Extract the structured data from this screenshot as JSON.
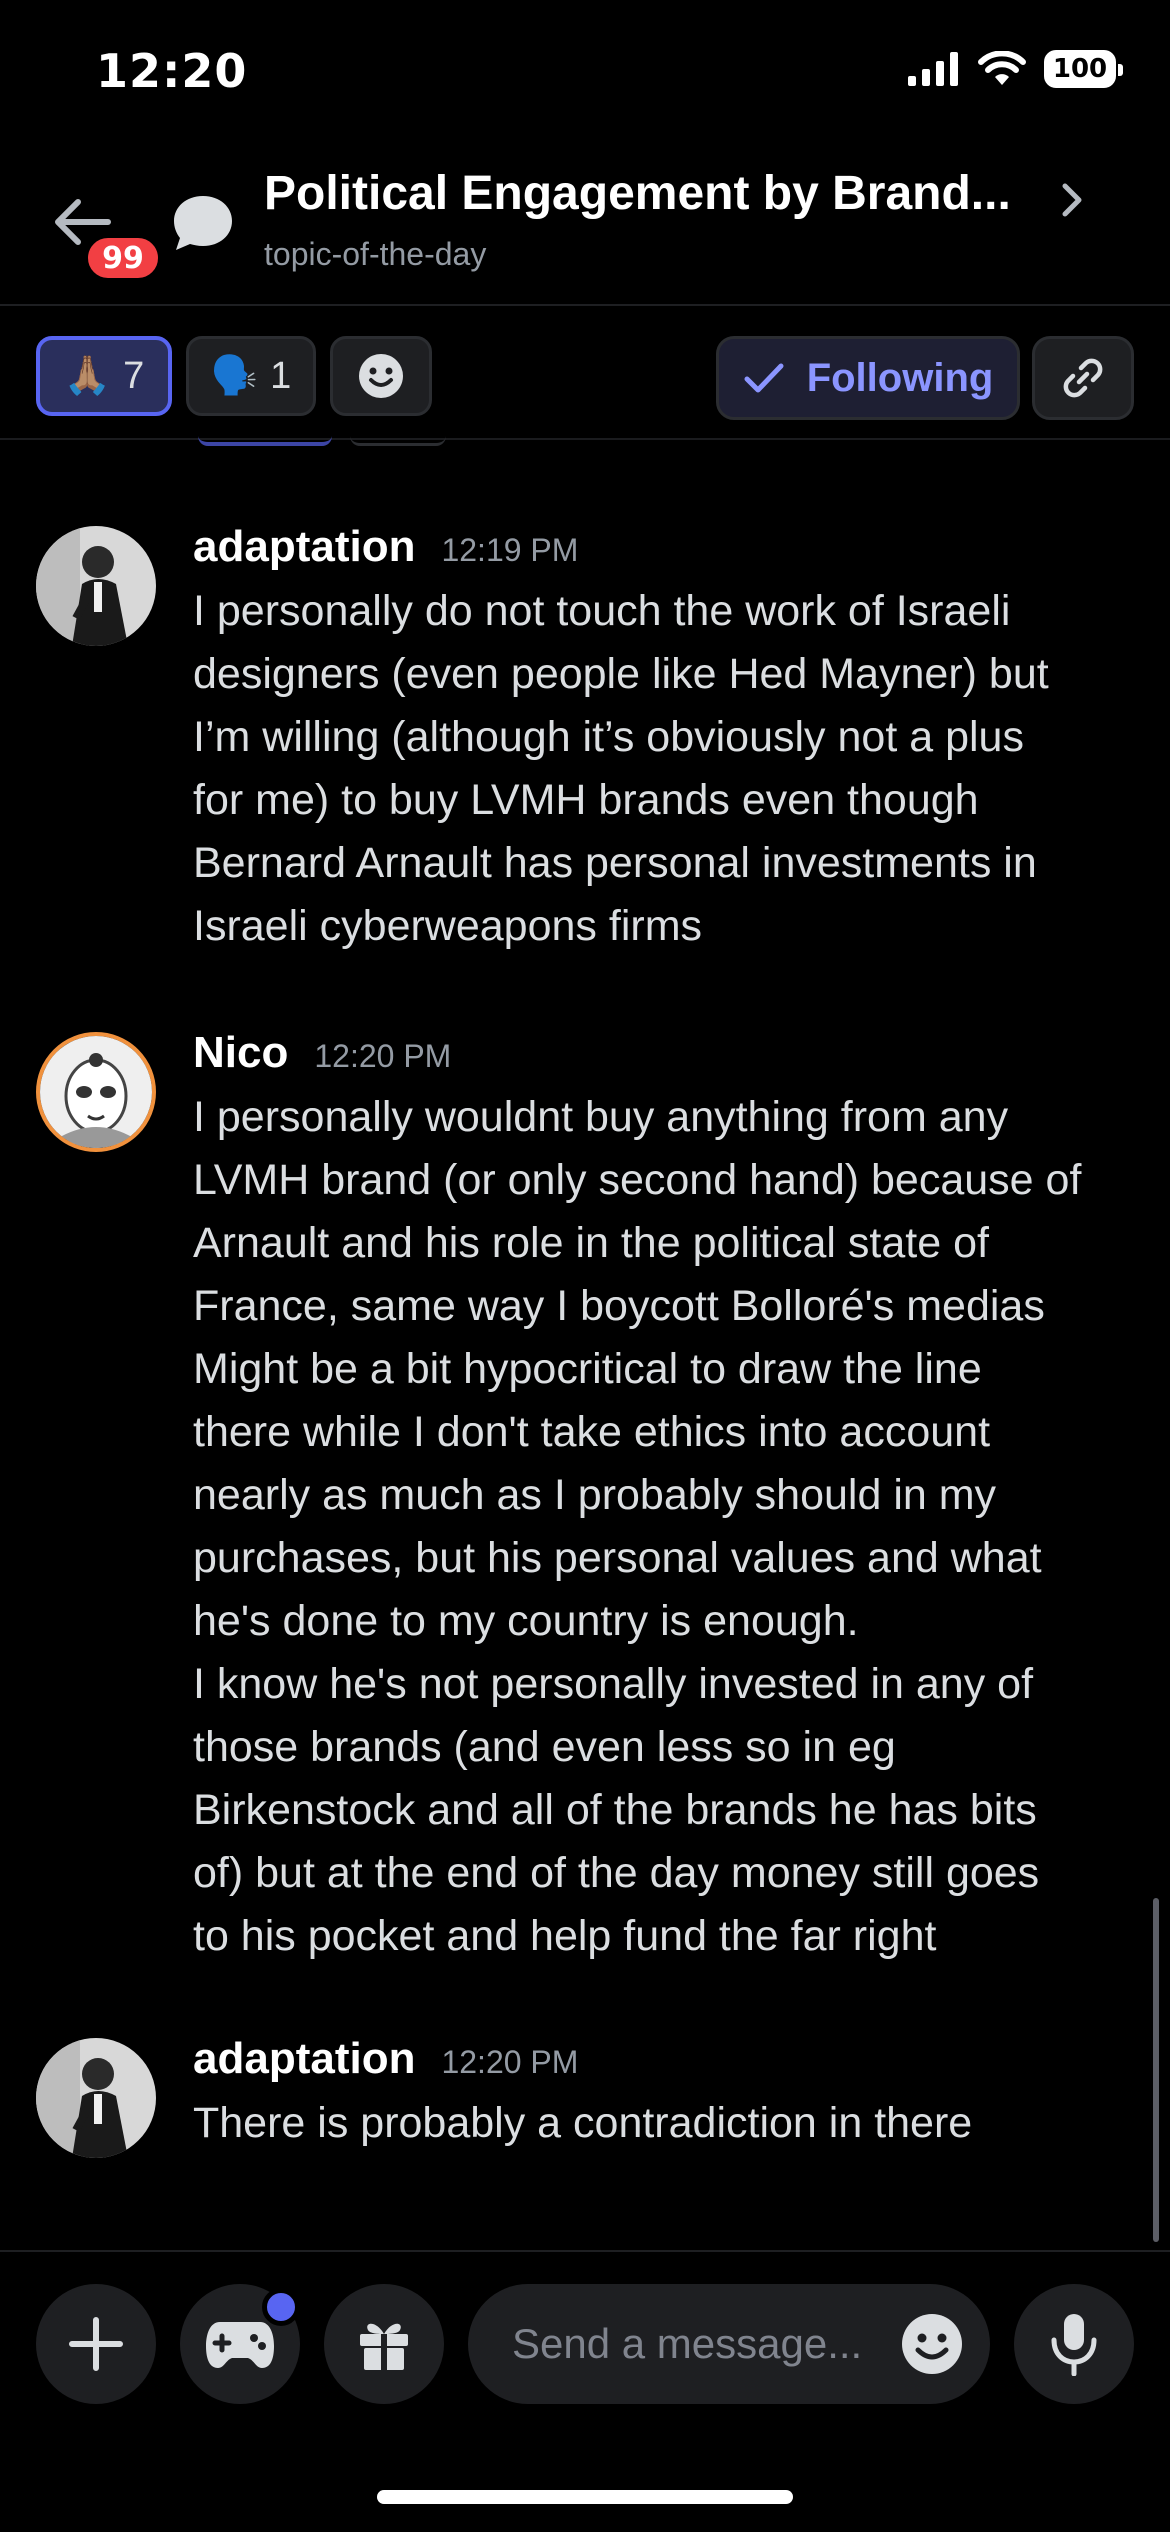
{
  "status_bar": {
    "time": "12:20",
    "battery": "100"
  },
  "header": {
    "unread_badge": "99",
    "title": "Political Engagement by Brand...",
    "subtitle": "topic-of-the-day"
  },
  "reactions": [
    {
      "emoji": "🙏🏽",
      "count": "7",
      "active": true
    },
    {
      "emoji": "🗣️",
      "count": "1",
      "active": false
    }
  ],
  "actions": {
    "following_label": "Following"
  },
  "messages": [
    {
      "author": "adaptation",
      "time": "12:19 PM",
      "text": "I personally do not touch the work of Israeli\ndesigners (even people like Hed Mayner) but\nI’m willing (although it’s obviously not a plus\nfor me) to buy LVMH brands even though\nBernard Arnault has personal investments in\nIsraeli cyberweapons firms"
    },
    {
      "author": "Nico",
      "time": "12:20 PM",
      "text": "I personally wouldnt buy anything from any\nLVMH brand (or only second hand) because of\nArnault and his role in the political state of\nFrance, same way I boycott Bolloré's medias\nMight be a bit hypocritical to draw the line\nthere while I don't take ethics into account\nnearly as much as I probably should in my\npurchases, but his personal values and what\nhe's done to my country is enough.\nI know he's not personally invested in any of\nthose brands (and even less so in eg\nBirkenstock and all of the brands he has bits\nof) but at the end of the day money still goes\nto his pocket and help fund the far right"
    },
    {
      "author": "adaptation",
      "time": "12:20 PM",
      "text": "There is probably a contradiction in there"
    }
  ],
  "composer": {
    "placeholder": "Send a message..."
  },
  "colors": {
    "accent": "#5865f2",
    "badge": "#f23f43",
    "background": "#000000"
  }
}
